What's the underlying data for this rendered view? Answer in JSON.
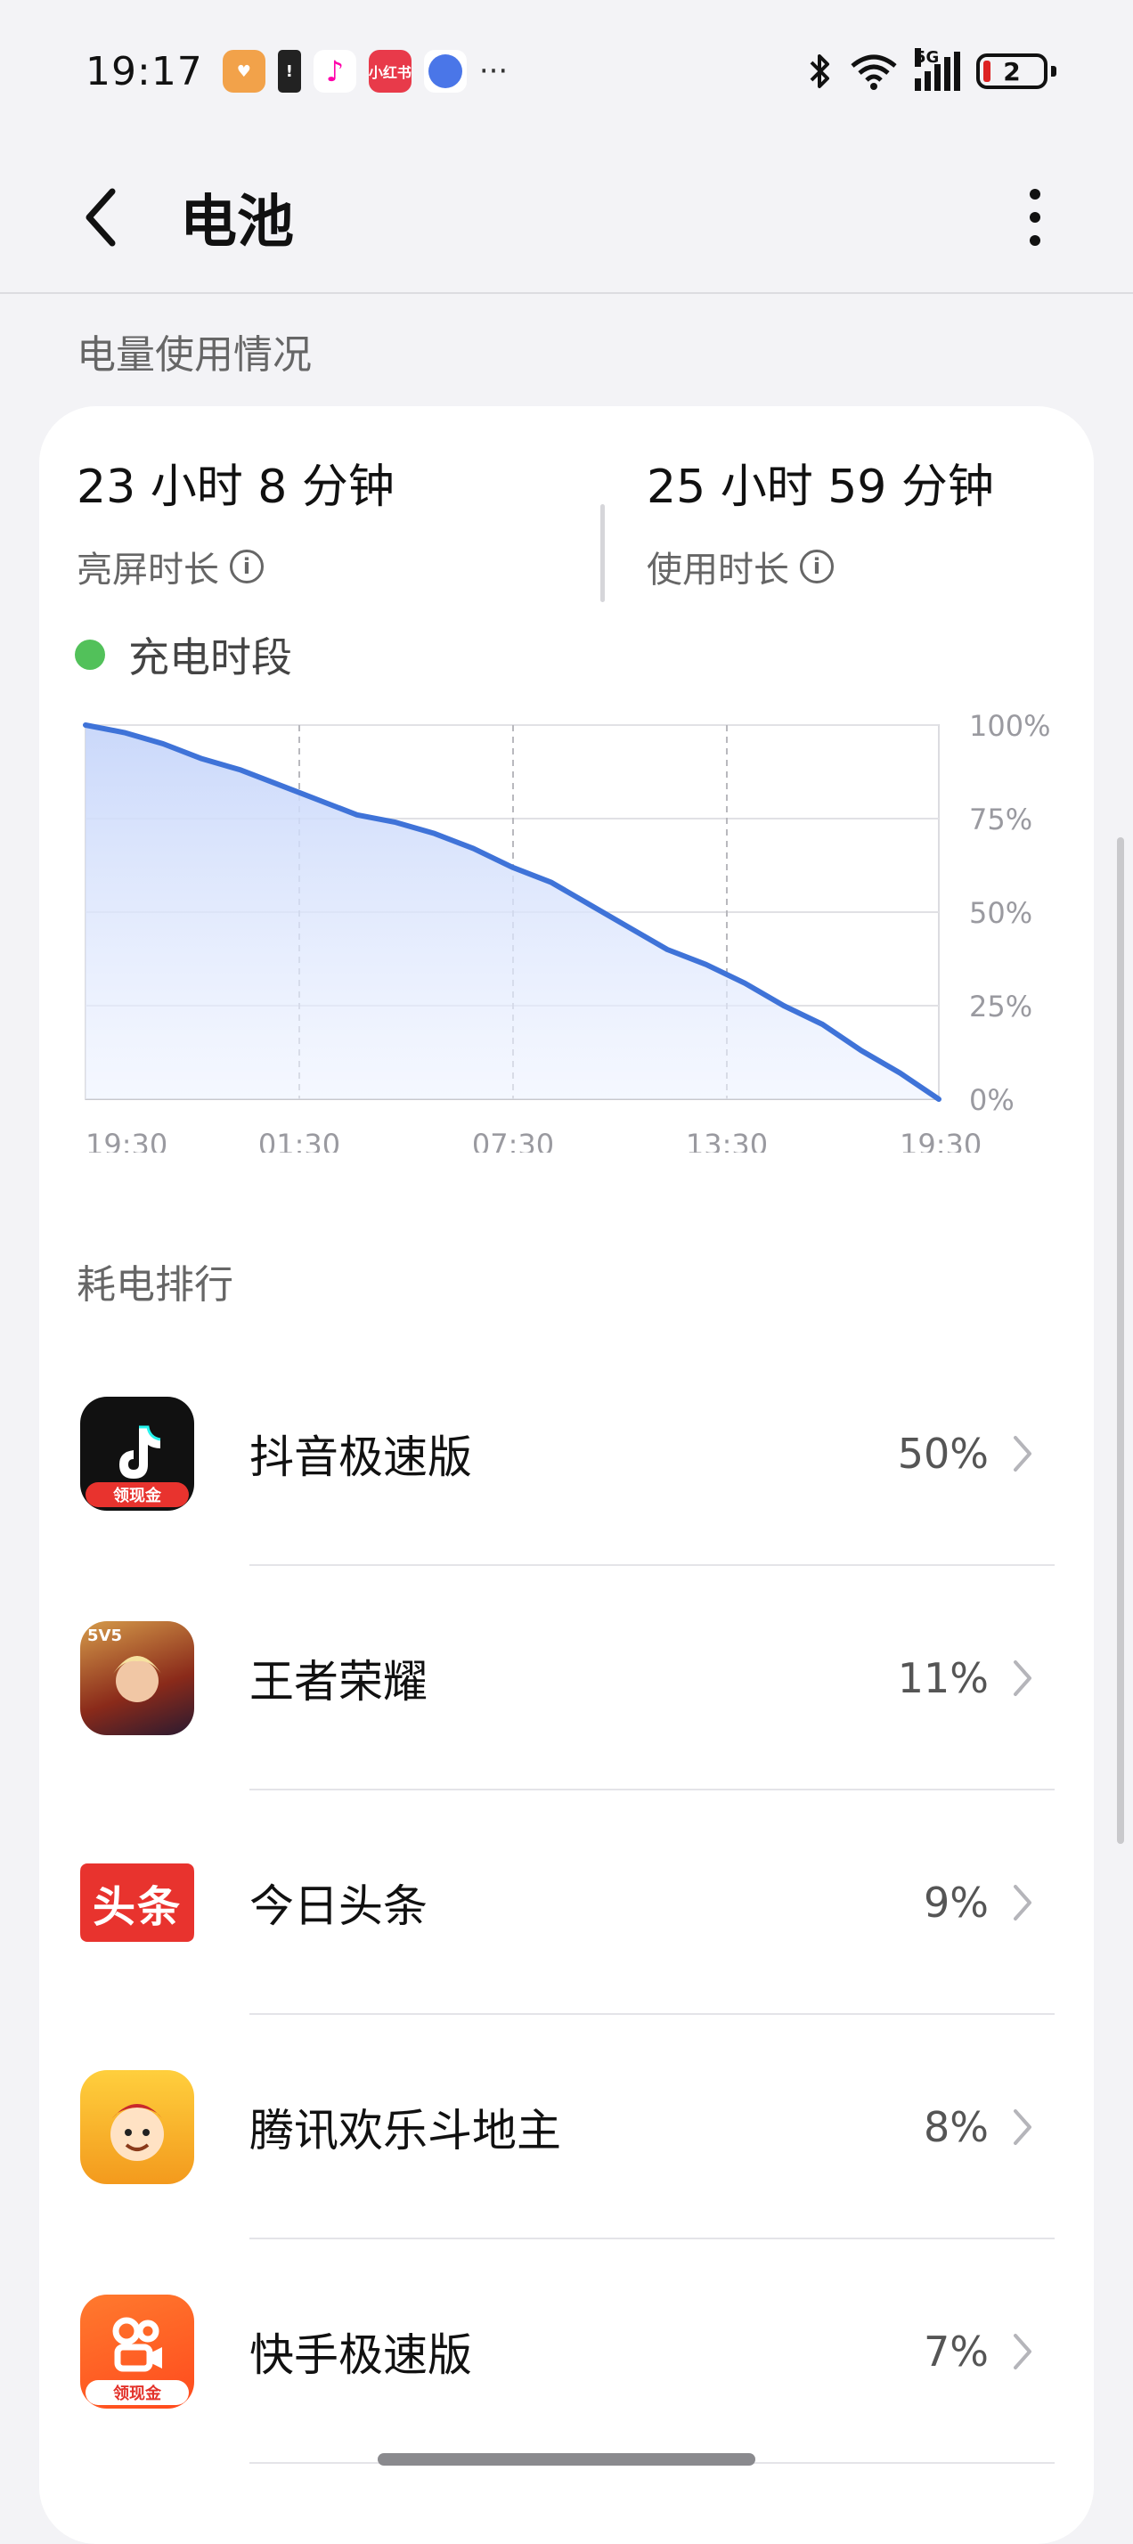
{
  "status_bar": {
    "time": "19:17",
    "notification_icons": [
      "heart-app-icon",
      "battery-warning-icon",
      "music-icon",
      "xiaohongshu-icon",
      "planet-app-icon"
    ],
    "more": "···",
    "network": "5G",
    "battery_level": "2",
    "colors": {
      "battery_low": "#dd2222"
    }
  },
  "header": {
    "title": "电池"
  },
  "usage": {
    "heading": "电量使用情况",
    "screen_time_value": "23 小时 8 分钟",
    "screen_time_label": "亮屏时长",
    "usage_time_value": "25 小时 59 分钟",
    "usage_time_label": "使用时长"
  },
  "legend": {
    "label": "充电时段",
    "color": "#52c15a"
  },
  "chart_data": {
    "type": "area",
    "title": "",
    "xlabel": "",
    "ylabel": "",
    "x_ticks": [
      "19:30",
      "01:30",
      "07:30",
      "13:30",
      "19:30"
    ],
    "y_ticks": [
      "100%",
      "75%",
      "50%",
      "25%",
      "0%"
    ],
    "ylim": [
      0,
      100
    ],
    "grid": true,
    "line_color": "#3f73d8",
    "series": [
      {
        "values": [
          100,
          98,
          95,
          91,
          88,
          84,
          80,
          76,
          74,
          71,
          67,
          62,
          58,
          52,
          46,
          40,
          36,
          31,
          25,
          20,
          13,
          7,
          0
        ]
      }
    ]
  },
  "ranking": {
    "title": "耗电排行",
    "apps": [
      {
        "name": "抖音极速版",
        "percent": "50%",
        "icon": "douyin-lite-icon",
        "badge": "领现金"
      },
      {
        "name": "王者荣耀",
        "percent": "11%",
        "icon": "honor-of-kings-icon",
        "badge": "5V5"
      },
      {
        "name": "今日头条",
        "percent": "9%",
        "icon": "toutiao-icon",
        "badge": "头条"
      },
      {
        "name": "腾讯欢乐斗地主",
        "percent": "8%",
        "icon": "doudizhu-icon",
        "badge": ""
      },
      {
        "name": "快手极速版",
        "percent": "7%",
        "icon": "kuaishou-lite-icon",
        "badge": "领现金"
      }
    ]
  }
}
